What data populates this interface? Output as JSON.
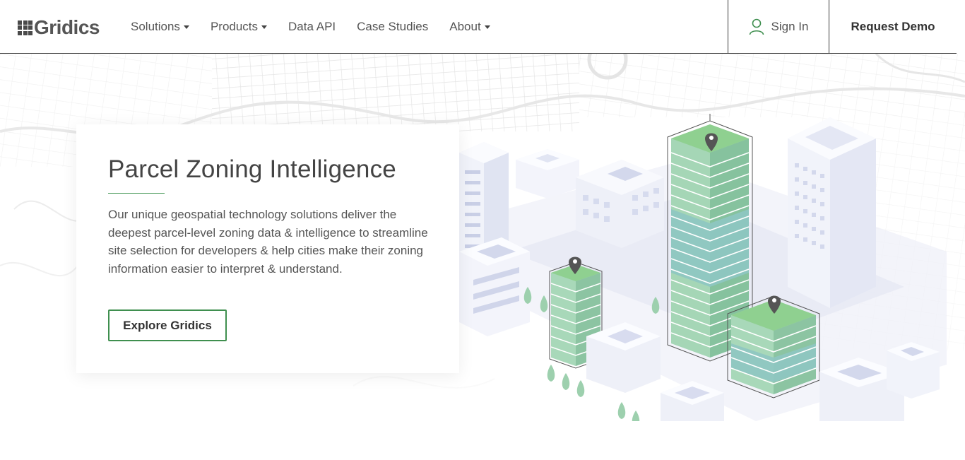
{
  "brand": {
    "name": "Gridics",
    "accent": "#3f8f4f",
    "icon": "grid-logo-icon"
  },
  "nav": {
    "items": [
      {
        "label": "Solutions",
        "dropdown": true
      },
      {
        "label": "Products",
        "dropdown": true
      },
      {
        "label": "Data API",
        "dropdown": false
      },
      {
        "label": "Case Studies",
        "dropdown": false
      },
      {
        "label": "About",
        "dropdown": true
      }
    ],
    "sign_in": "Sign In",
    "request_demo": "Request Demo"
  },
  "hero": {
    "title": "Parcel Zoning Intelligence",
    "body": "Our unique geospatial technology solutions deliver the deepest parcel-level zoning data & intelligence to streamline site selection for developers & help cities make their zoning information easier to interpret & understand.",
    "cta": "Explore Gridics"
  }
}
